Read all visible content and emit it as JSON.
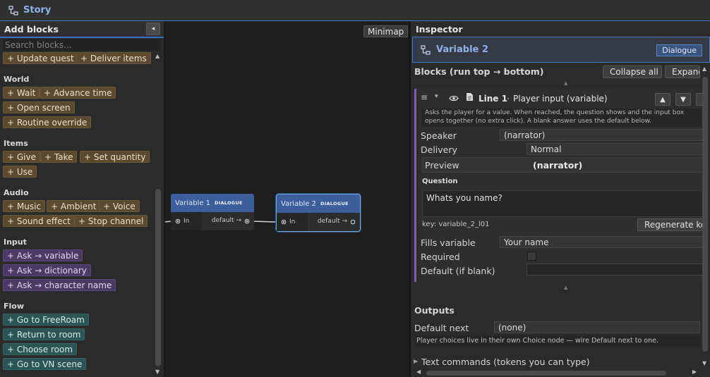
{
  "window": {
    "title": "Story",
    "icon": "story-graph-icon"
  },
  "palette": {
    "title": "Add blocks",
    "collapse_label": "◂",
    "search_placeholder": "Search blocks...",
    "top_items": [
      "+ Update quest",
      "+ Deliver items"
    ],
    "categories": {
      "world": {
        "title": "World",
        "items": [
          "+ Wait",
          "+ Advance time",
          "+ Open screen",
          "+ Routine override"
        ]
      },
      "items": {
        "title": "Items",
        "items": [
          "+ Give",
          "+ Take",
          "+ Set quantity",
          "+ Use"
        ]
      },
      "audio": {
        "title": "Audio",
        "items": [
          "+ Music",
          "+ Ambient",
          "+ Voice",
          "+ Sound effect",
          "+ Stop channel"
        ]
      },
      "input": {
        "title": "Input",
        "items": [
          "+ Ask → variable",
          "+ Ask → dictionary",
          "+ Ask → character name"
        ]
      },
      "flow": {
        "title": "Flow",
        "items": [
          "+ Go to FreeRoam",
          "+ Return to room",
          "+ Choose room",
          "+ Go to VN scene"
        ]
      }
    },
    "colors": {
      "quest": "#5b4a2e",
      "input": "#4a3a64",
      "flow": "#2b5455"
    }
  },
  "canvas": {
    "minimap_label": "Minimap",
    "nodes": [
      {
        "name": "Variable 1",
        "tag": "DIALOGUE",
        "in_label": "In",
        "out_label": "default →",
        "selected": false
      },
      {
        "name": "Variable 2",
        "tag": "DIALOGUE",
        "in_label": "In",
        "out_label": "default →",
        "selected": true
      }
    ]
  },
  "inspector": {
    "title": "Inspector",
    "header": {
      "title": "Variable 2",
      "badge": "Dialogue",
      "icon": "node-icon"
    },
    "blocks_label": "Blocks (run top → bottom)",
    "collapse_all": "Collapse all",
    "expand_all": "Expand all",
    "line": {
      "drag_handle": "≡",
      "fold": "▾",
      "title": "Line 1",
      "separator": "·",
      "kind": "Player input (variable)",
      "move_up": "▲",
      "move_down": "▼",
      "help": "Asks the player for a value. When reached, the question shows and the input box opens together (no extra click). A blank answer uses the default below.",
      "speaker_label": "Speaker",
      "speaker_value": "(narrator)",
      "delivery_label": "Delivery",
      "delivery_value": "Normal",
      "preview_label": "Preview",
      "preview_value": "(narrator)",
      "question_label": "Question",
      "question_value": "Whats you name?",
      "key_text": "key: variable_2_l01",
      "regenerate_label": "Regenerate key",
      "fills_label": "Fills variable",
      "fills_value": "Your name",
      "required_label": "Required",
      "required_checked": false,
      "default_label": "Default (if blank)",
      "default_value": ""
    },
    "outputs_label": "Outputs",
    "default_next_label": "Default next",
    "default_next_value": "(none)",
    "choices_note": "Player choices live in their own Choice node — wire Default next to one.",
    "text_commands_label": "Text commands (tokens you can type)"
  }
}
